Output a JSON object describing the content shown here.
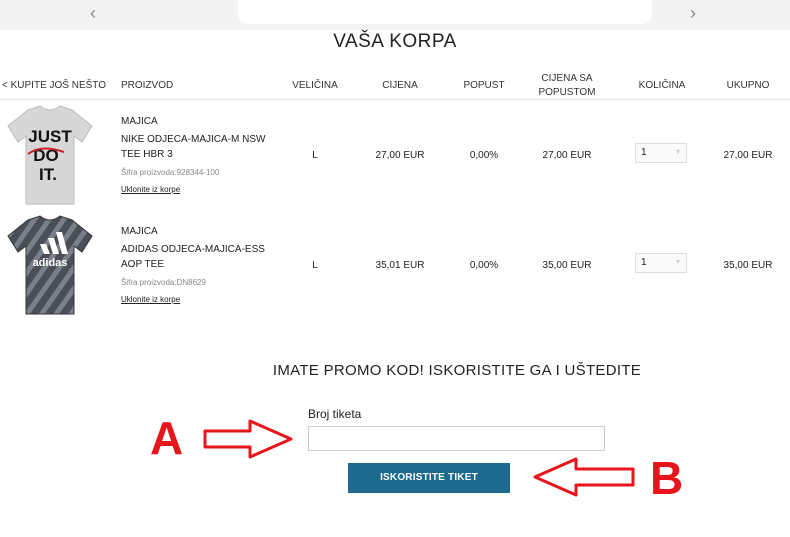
{
  "nav": {
    "prev_icon": "chevron-left-icon",
    "next_icon": "chevron-right-icon",
    "prev": "‹",
    "next": "›"
  },
  "page_title": "VAŠA KORPA",
  "table": {
    "back_link": "< KUPITE JOŠ NEŠTO",
    "headers": {
      "product": "PROIZVOD",
      "size": "VELIČINA",
      "price": "CIJENA",
      "discount": "POPUST",
      "discounted_price_1": "CIJENA SA",
      "discounted_price_2": "POPUSTOM",
      "quantity": "KOLIČINA",
      "total": "UKUPNO"
    },
    "rows": [
      {
        "category": "MAJICA",
        "name": "NIKE ODJECA-MAJICA-M NSW TEE HBR 3",
        "sku": "Šifra proizvoda:928344-100",
        "remove": "Uklonite iz korpe",
        "size": "L",
        "price": "27,00 EUR",
        "discount": "0,00%",
        "discounted_price": "27,00 EUR",
        "quantity": "1",
        "total": "27,00 EUR",
        "image_text": [
          "JUST",
          "DO",
          "IT."
        ]
      },
      {
        "category": "MAJICA",
        "name": "ADIDAS ODJECA-MAJICA-ESS AOP TEE",
        "sku": "Šifra proizvoda:DN8629",
        "remove": "Uklonite iz korpe",
        "size": "L",
        "price": "35,01 EUR",
        "discount": "0,00%",
        "discounted_price": "35,00 EUR",
        "quantity": "1",
        "total": "35,00 EUR",
        "image_text": [
          "adidas"
        ]
      }
    ]
  },
  "promo": {
    "title": "IMATE PROMO KOD! ISKORISTITE GA I UŠTEDITE",
    "field_label": "Broj tiketa",
    "field_value": "",
    "field_placeholder": "",
    "button_label": "ISKORISTITE TIKET"
  },
  "annotations": {
    "a_label": "A",
    "b_label": "B",
    "color": "#e8141b"
  },
  "colors": {
    "button": "#1e6a8f",
    "topbar": "#f3f3f3"
  }
}
